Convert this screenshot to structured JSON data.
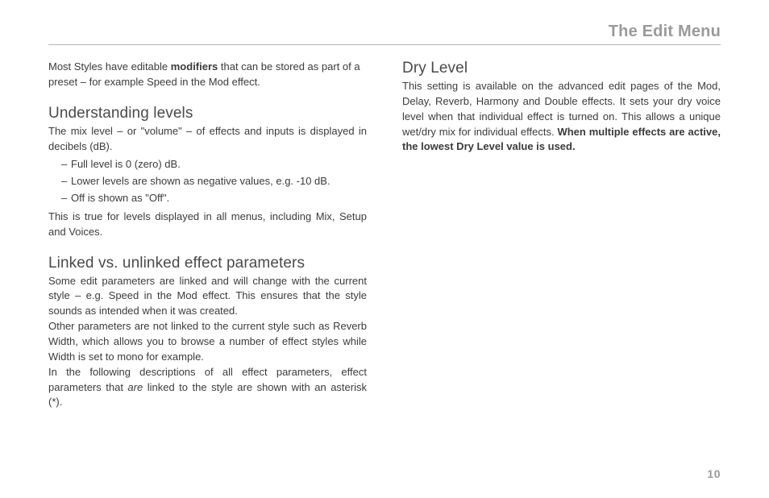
{
  "header": {
    "title": "The Edit Menu"
  },
  "page_number": "10",
  "left": {
    "intro_pre": "Most Styles have editable ",
    "intro_bold": "modifiers",
    "intro_post": " that can be stored as part of a preset – for example Speed in the Mod effect.",
    "levels_heading": "Understanding levels",
    "levels_body1": "The mix level – or \"volume\" – of effects and inputs is displayed in decibels (dB).",
    "levels_items": {
      "i0": "Full level is 0 (zero) dB.",
      "i1": "Lower levels are shown as negative values, e.g. -10 dB.",
      "i2": "Off is shown as \"Off\"."
    },
    "levels_body2": "This is true for levels displayed in all menus, including Mix, Setup and Voices.",
    "linked_heading": "Linked vs. unlinked effect parameters",
    "linked_body1": "Some edit parameters are linked and will change with the current style – e.g. Speed in the Mod effect. This ensures that the style sounds as intended when it was created.",
    "linked_body2": "Other parameters are not linked to the current style such as Reverb Width, which allows you to browse a number of effect styles while Width is set to mono for example.",
    "linked_body3_pre": "In the following descriptions of all effect parameters, effect parameters that ",
    "linked_body3_em": "are",
    "linked_body3_post": " linked to the style are shown with an asterisk (*)."
  },
  "right": {
    "dry_heading": "Dry Level",
    "dry_body_pre": "This setting is available on the advanced edit pages of the Mod, Delay, Reverb, Harmony and Double effects. It sets your dry voice level when that individual effect is turned on. This allows a unique wet/dry mix for individual effects. ",
    "dry_body_bold": "When multiple effects are active, the lowest Dry Level value is used."
  }
}
